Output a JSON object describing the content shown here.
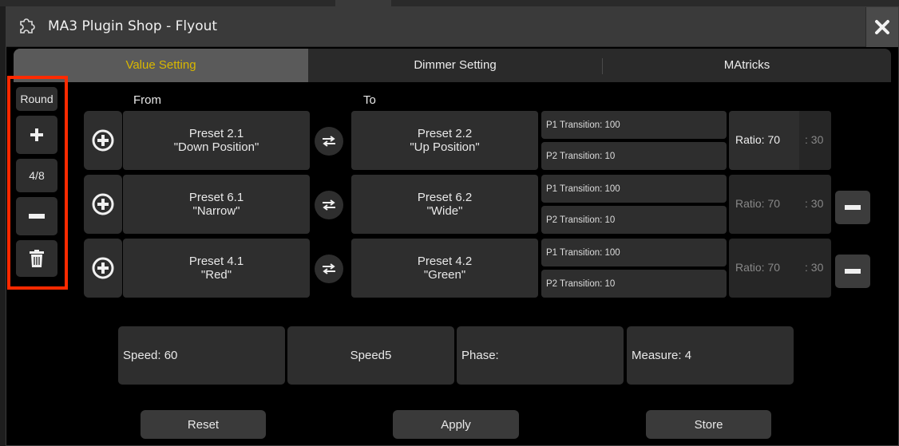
{
  "window": {
    "title": "MA3 Plugin Shop - Flyout"
  },
  "tabs": [
    {
      "label": "Value Setting",
      "active": true
    },
    {
      "label": "Dimmer Setting",
      "active": false
    },
    {
      "label": "MAtricks",
      "active": false
    }
  ],
  "sidebar": {
    "round_label": "Round",
    "count": "4/8"
  },
  "headers": {
    "from": "From",
    "to": "To"
  },
  "rows": [
    {
      "from_line1": "Preset 2.1",
      "from_line2": "\"Down Position\"",
      "to_line1": "Preset 2.2",
      "to_line2": "\"Up Position\"",
      "p1": "P1 Transition: 100",
      "p2": "P2 Transition: 10",
      "ratio": "Ratio: 70",
      "ratio_rest": ": 30",
      "enabled": true
    },
    {
      "from_line1": "Preset 6.1",
      "from_line2": "\"Narrow\"",
      "to_line1": "Preset 6.2",
      "to_line2": "\"Wide\"",
      "p1": "P1 Transition: 100",
      "p2": "P2 Transition: 10",
      "ratio": "Ratio: 70",
      "ratio_rest": ": 30",
      "enabled": false
    },
    {
      "from_line1": "Preset 4.1",
      "from_line2": "\"Red\"",
      "to_line1": "Preset 4.2",
      "to_line2": "\"Green\"",
      "p1": "P1 Transition: 100",
      "p2": "P2 Transition: 10",
      "ratio": "Ratio: 70",
      "ratio_rest": ": 30",
      "enabled": false
    }
  ],
  "info": {
    "speed": "Speed: 60",
    "speed_group": "Speed5",
    "phase": "Phase:",
    "measure": "Measure: 4"
  },
  "buttons": {
    "reset": "Reset",
    "apply": "Apply",
    "store": "Store"
  },
  "colors": {
    "accent": "#d9b800",
    "highlight": "#ff2a00"
  }
}
